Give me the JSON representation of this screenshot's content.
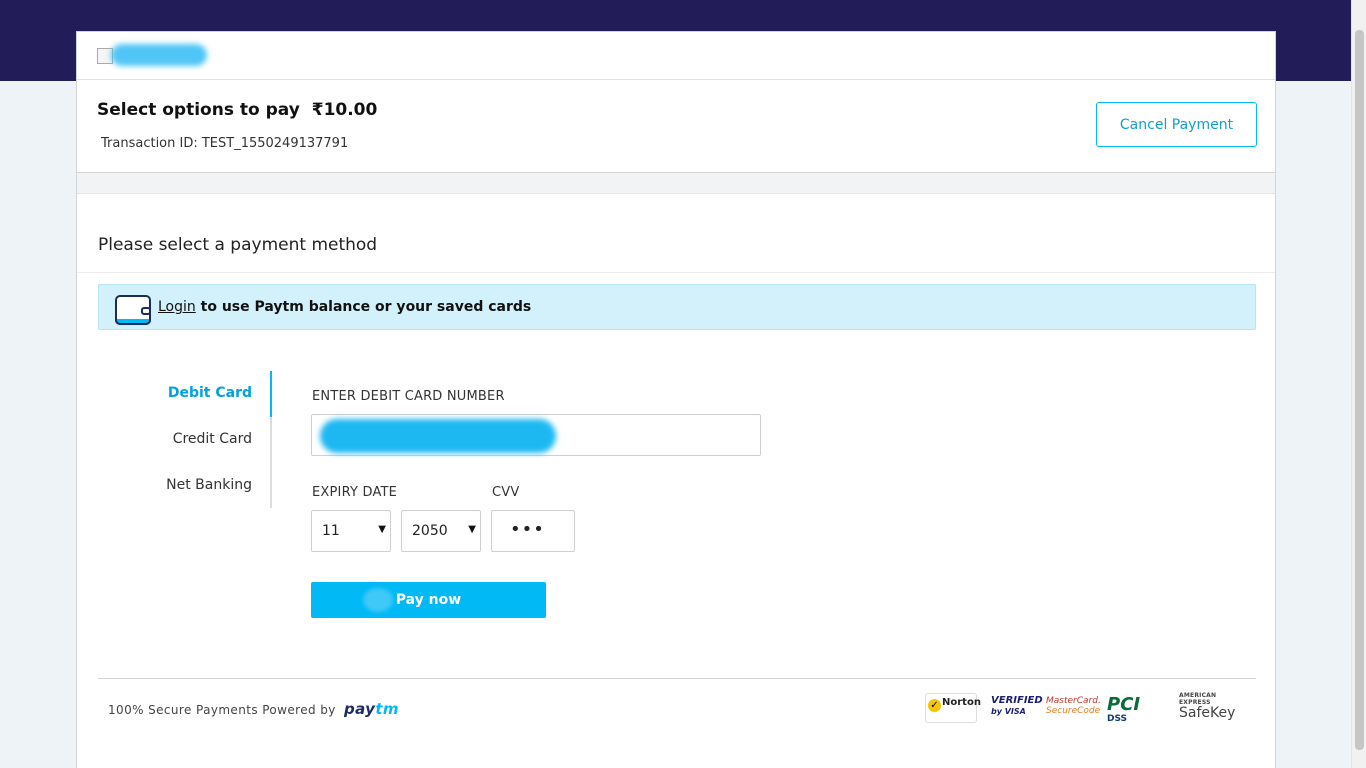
{
  "header": {
    "title": "Select options to pay",
    "currency_symbol": "₹",
    "amount": "10.00",
    "transaction_label": "Transaction ID: TEST_1550249137791",
    "cancel_label": "Cancel Payment"
  },
  "main": {
    "section_title": "Please select a payment method",
    "login_banner": {
      "link_text": "Login",
      "rest_text": " to use Paytm balance or your saved cards"
    },
    "tabs": [
      {
        "label": "Debit Card",
        "active": true
      },
      {
        "label": "Credit Card",
        "active": false
      },
      {
        "label": "Net Banking",
        "active": false
      }
    ],
    "form": {
      "card_number_label": "ENTER DEBIT CARD NUMBER",
      "expiry_label": "EXPIRY DATE",
      "cvv_label": "CVV",
      "expiry_month": "11",
      "expiry_year": "2050",
      "cvv_value": "•••",
      "pay_label": "Pay now"
    }
  },
  "footer": {
    "secure_text": "100% Secure Payments Powered by",
    "brand_part1": "pay",
    "brand_part2": "tm",
    "badges": {
      "norton": "Norton",
      "visa_line1": "VERIFIED",
      "visa_line2": "by VISA",
      "mc_line1": "MasterCard.",
      "mc_line2": "SecureCode",
      "pci": "PCI",
      "pci_dss": "DSS",
      "safekey_top": "AMERICAN EXPRESS",
      "safekey": "SafeKey"
    }
  },
  "colors": {
    "top_band": "#221d59",
    "accent": "#00b9f5",
    "login_banner_bg": "#d3f1fb"
  }
}
